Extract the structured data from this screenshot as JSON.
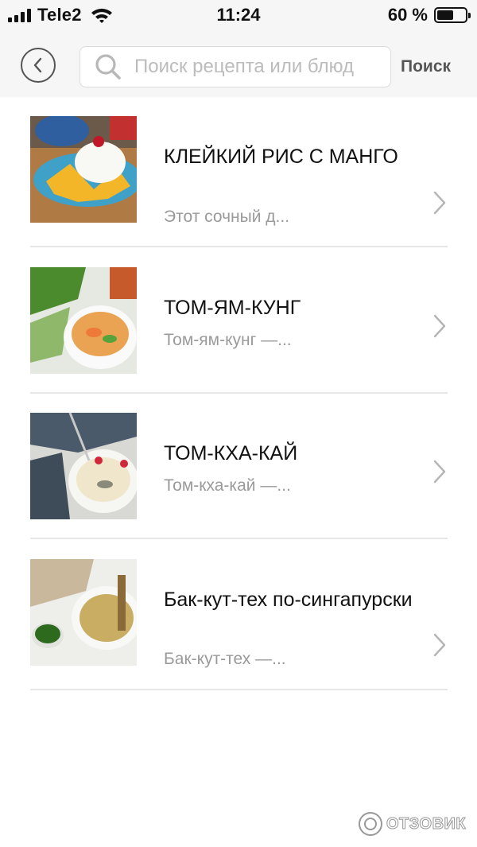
{
  "status_bar": {
    "carrier": "Tele2",
    "time": "11:24",
    "battery_percent": "60 %",
    "battery_level": 0.6,
    "signal_bars": 4
  },
  "nav": {
    "back_icon": "chevron-left-icon",
    "search": {
      "placeholder": "Поиск рецепта или блюд",
      "value": ""
    },
    "search_button_label": "Поиск"
  },
  "recipes": [
    {
      "title": "КЛЕЙКИЙ РИС С МАНГО",
      "subtitle": "Этот сочный д...",
      "image": "mango-sticky-rice"
    },
    {
      "title": "ТОМ-ЯМ-КУНГ",
      "subtitle": "Том-ям-кунг —...",
      "image": "tom-yum-soup"
    },
    {
      "title": "ТОМ-КХА-КАЙ",
      "subtitle": "Том-кха-кай —...",
      "image": "tom-kha-soup"
    },
    {
      "title": "Бак-кут-тех по-сингапурски",
      "subtitle": "Бак-кут-тех —...",
      "image": "bak-kut-teh"
    }
  ],
  "watermark": {
    "label": "ОТЗОВИК"
  },
  "colors": {
    "bar_bg": "#f6f6f6",
    "divider": "#e6e6e6",
    "muted_text": "#9a9a9a"
  }
}
